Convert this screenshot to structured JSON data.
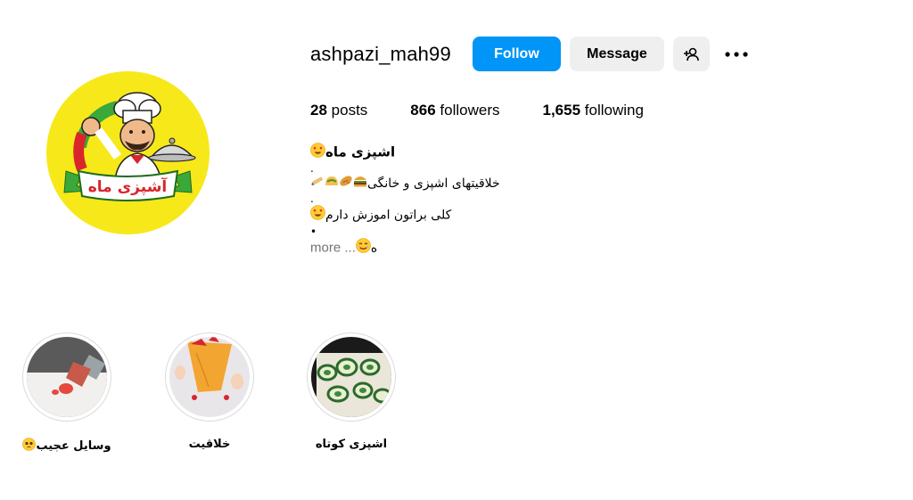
{
  "profile": {
    "username": "ashpazi_mah99",
    "follow_label": "Follow",
    "message_label": "Message",
    "avatar_text": "آشپزی ماه"
  },
  "stats": {
    "posts_count": "28",
    "posts_label": "posts",
    "followers_count": "866",
    "followers_label": "followers",
    "following_count": "1,655",
    "following_label": "following"
  },
  "bio": {
    "name": "اشپزی ماه",
    "dot1": ".",
    "line1": "خلاقیتهای اشپزی و خانگی",
    "dot2": ".",
    "line2": "کلی براتون اموزش دارم",
    "dot3": "•",
    "line3_start": "ه",
    "more": "... more"
  },
  "highlights": [
    {
      "label": "اشپزی کوتاه"
    },
    {
      "label": "خلاقیت"
    },
    {
      "label": "وسایل عجیب"
    }
  ],
  "icons": {
    "add_user": "add-user-icon",
    "more": "more-horizontal-icon"
  },
  "colors": {
    "follow_button": "#0095f6",
    "secondary_button": "#efefef",
    "avatar_bg": "#f7e81a",
    "muted_text": "#737373"
  }
}
